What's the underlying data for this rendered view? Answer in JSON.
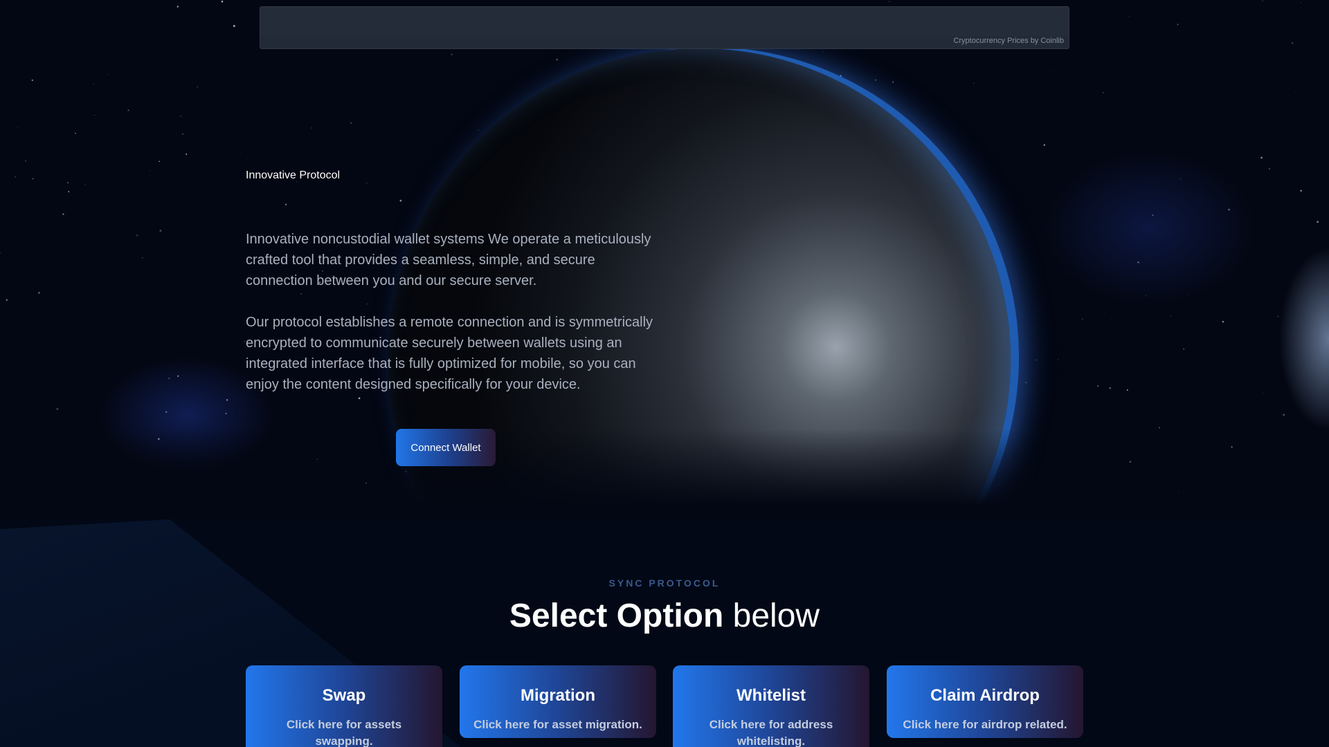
{
  "ticker": {
    "credit": "Cryptocurrency Prices by Coinlib"
  },
  "hero": {
    "eyebrow": "Innovative Protocol",
    "paragraph1": "Innovative noncustodial wallet systems We operate a meticulously crafted tool that provides a seamless, simple, and secure connection between you and our secure server.",
    "paragraph2": "Our protocol establishes a remote connection and is symmetrically encrypted to communicate securely between wallets using an integrated interface that is fully optimized for mobile, so you can enjoy the content designed specifically for your device.",
    "connect_label": "Connect Wallet"
  },
  "options": {
    "kicker": "SYNC PROTOCOL",
    "heading_bold": "Select Option",
    "heading_light": "below",
    "cards": [
      {
        "title": "Swap",
        "desc": "Click here for assets swapping."
      },
      {
        "title": "Migration",
        "desc": "Click here for asset migration."
      },
      {
        "title": "Whitelist",
        "desc": "Click here for address whitelisting."
      },
      {
        "title": "Claim Airdrop",
        "desc": "Click here for airdrop related."
      }
    ]
  },
  "colors": {
    "accent": "#2176e8",
    "background": "#030713",
    "text_muted": "#a9b0bf"
  }
}
